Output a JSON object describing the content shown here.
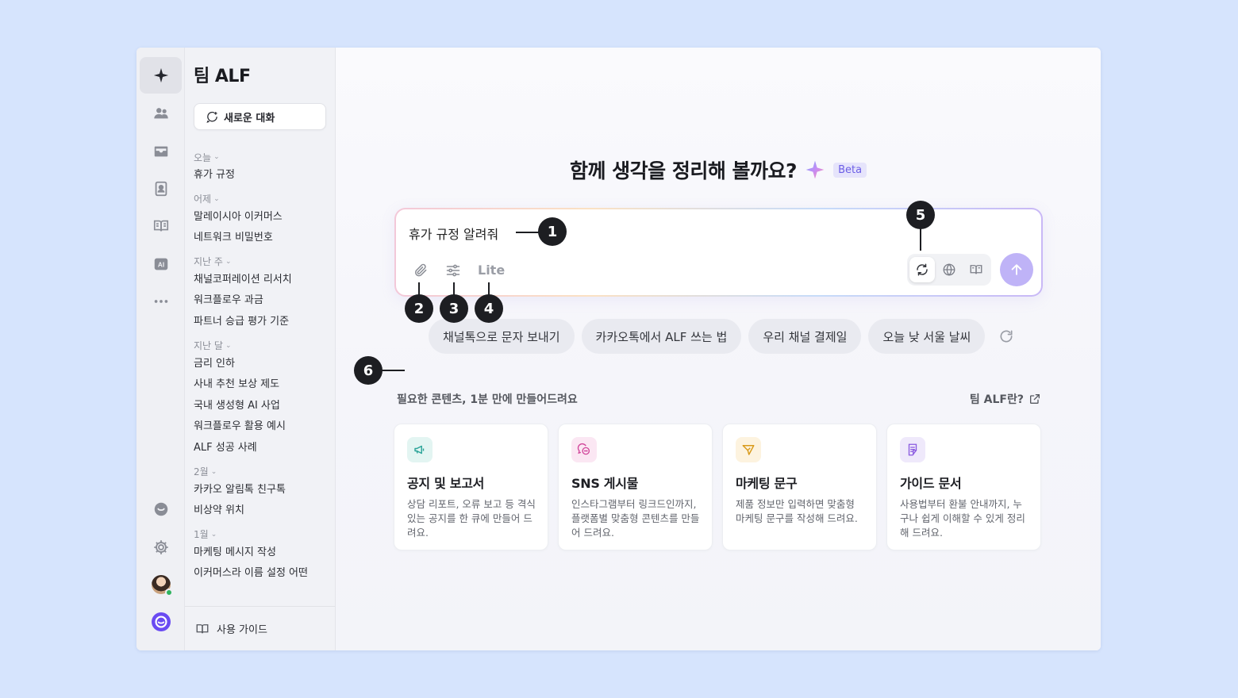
{
  "sidebar": {
    "title": "팀 ALF",
    "new_chat_label": "새로운 대화",
    "groups": [
      {
        "label": "오늘",
        "items": [
          "휴가 규정"
        ]
      },
      {
        "label": "어제",
        "items": [
          "말레이시아 이커머스",
          "네트워크 비밀번호"
        ]
      },
      {
        "label": "지난 주",
        "items": [
          "채널코퍼레이션 리서치",
          "워크플로우 과금",
          "파트너 승급 평가 기준"
        ]
      },
      {
        "label": "지난 달",
        "items": [
          "금리 인하",
          "사내 추천 보상 제도",
          "국내 생성형 AI 사업",
          "워크플로우 활용 예시",
          "ALF 성공 사례"
        ]
      },
      {
        "label": "2월",
        "items": [
          "카카오 알림톡 친구톡",
          "비상약 위치"
        ]
      },
      {
        "label": "1월",
        "items": [
          "마케팅 메시지 작성",
          "이커머스라 이름 설정 어떤"
        ]
      }
    ],
    "footer_label": "사용 가이드"
  },
  "rail": {
    "items": [
      "sparkle-icon",
      "team-icon",
      "inbox-icon",
      "contact-icon",
      "book-icon",
      "ai-icon",
      "more-icon"
    ],
    "bottom": [
      "chat-bubble-icon",
      "settings-icon",
      "avatar",
      "brand-icon"
    ]
  },
  "main": {
    "headline": "함께 생각을 정리해 볼까요?",
    "beta_label": "Beta",
    "composer": {
      "text": "휴가 규정 알려줘",
      "mode_label": "Lite"
    },
    "suggestions": [
      "채널톡으로 문자 보내기",
      "카카오톡에서 ALF 쓰는 법",
      "우리 채널 결제일",
      "오늘 낮 서울 날씨"
    ],
    "section_title": "필요한 콘텐츠, 1분 만에 만들어드려요",
    "section_link": "팀 ALF란?",
    "cards": [
      {
        "title": "공지 및 보고서",
        "desc": "상담 리포트, 오류 보고 등 격식 있는 공지를 한 큐에 만들어 드려요.",
        "icon": "megaphone-icon",
        "icon_bg": "#e3f5f2",
        "icon_color": "#2aa398"
      },
      {
        "title": "SNS 게시물",
        "desc": "인스타그램부터 링크드인까지, 플랫폼별 맞춤형 콘텐츠를 만들어 드려요.",
        "icon": "chat-icon",
        "icon_bg": "#fbe7f3",
        "icon_color": "#d1459a"
      },
      {
        "title": "마케팅 문구",
        "desc": "제품 정보만 입력하면 맞춤형 마케팅 문구를 작성해 드려요.",
        "icon": "send-icon",
        "icon_bg": "#fdf3df",
        "icon_color": "#d99a1a"
      },
      {
        "title": "가이드 문서",
        "desc": "사용법부터 환불 안내까지, 누구나 쉽게 이해할 수 있게 정리해 드려요.",
        "icon": "document-icon",
        "icon_bg": "#efe9fb",
        "icon_color": "#8a5ae0"
      }
    ]
  },
  "annotations": [
    "1",
    "2",
    "3",
    "4",
    "5",
    "6"
  ],
  "colors": {
    "page_bg": "#d6e4fd",
    "accent": "#6a4bf2",
    "send": "#bfb3f7",
    "marker": "#1d1e22"
  }
}
